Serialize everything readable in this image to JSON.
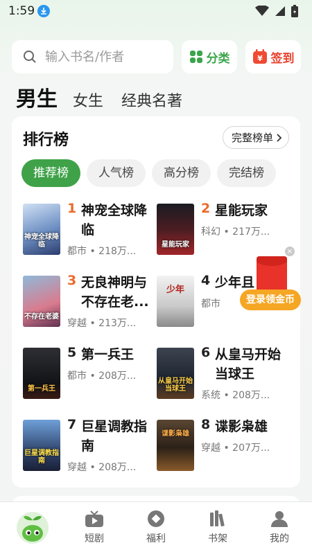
{
  "status_bar": {
    "time": "1:59"
  },
  "search": {
    "placeholder": "输入书名/作者"
  },
  "header_buttons": {
    "category": "分类",
    "sign_in": "签到"
  },
  "gender_tabs": [
    "男生",
    "女生",
    "经典名著"
  ],
  "ranking": {
    "title": "排行榜",
    "full_list": "完整榜单",
    "chips": [
      "推荐榜",
      "人气榜",
      "高分榜",
      "完结榜"
    ],
    "books": [
      {
        "rank": "1",
        "title": "神宠全球降临",
        "meta": "都市 • 218万...",
        "cover_text": "神宠全球降临"
      },
      {
        "rank": "2",
        "title": "星能玩家",
        "meta": "科幻 • 217万...",
        "cover_text": "星能玩家"
      },
      {
        "rank": "3",
        "title": "无良神明与不存在老...",
        "meta": "穿越 • 213万...",
        "cover_text": "不存在老婆"
      },
      {
        "rank": "4",
        "title": "少年且",
        "meta": "都市",
        "cover_text": "少年"
      },
      {
        "rank": "5",
        "title": "第一兵王",
        "meta": "都市 • 208万...",
        "cover_text": "第一兵王"
      },
      {
        "rank": "6",
        "title": "从皇马开始当球王",
        "meta": "系统 • 208万...",
        "cover_text": "从皇马开始当球王"
      },
      {
        "rank": "7",
        "title": "巨星调教指南",
        "meta": "穿越 • 208万...",
        "cover_text": "巨星调教指南"
      },
      {
        "rank": "8",
        "title": "谍影枭雄",
        "meta": "穿越 • 207万...",
        "cover_text": "谍影枭雄"
      }
    ]
  },
  "promo": {
    "label": "登录领金币"
  },
  "bottom_nav": {
    "items": [
      "短剧",
      "福利",
      "书架",
      "我的"
    ]
  },
  "colors": {
    "accent": "#3fa249",
    "rank_hot": "#ec6a2b",
    "sign_red": "#e8432e",
    "promo_orange": "#f5a623"
  }
}
